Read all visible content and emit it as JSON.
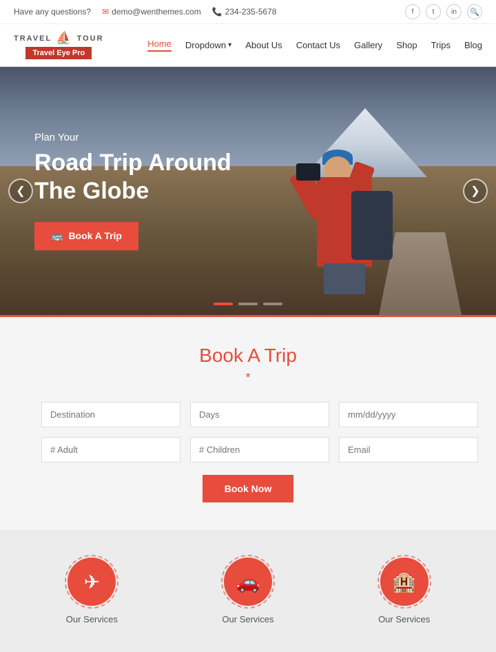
{
  "topbar": {
    "question": "Have any questions?",
    "email": "demo@wenthemes.com",
    "phone": "234-235-5678",
    "social": [
      "f",
      "t",
      "in"
    ],
    "search_symbol": "🔍"
  },
  "navbar": {
    "brand_line1": "TRAVEL",
    "brand_line2": "TOUR",
    "badge": "Travel Eye Pro",
    "links": [
      {
        "label": "Home",
        "active": true
      },
      {
        "label": "Dropdown",
        "has_arrow": true
      },
      {
        "label": "About Us"
      },
      {
        "label": "Contact Us"
      },
      {
        "label": "Gallery"
      },
      {
        "label": "Shop"
      },
      {
        "label": "Trips"
      },
      {
        "label": "Blog"
      }
    ]
  },
  "hero": {
    "subtitle": "Plan Your",
    "title_line1": "Road Trip Around",
    "title_line2": "The Globe",
    "cta_label": "Book A Trip",
    "dots": [
      {
        "active": true
      },
      {
        "active": false
      },
      {
        "active": false
      }
    ],
    "prev_arrow": "❮",
    "next_arrow": "❯"
  },
  "booking": {
    "title_prefix": "B",
    "title_rest": "ook A Trip",
    "divider_symbol": "*",
    "fields": [
      {
        "placeholder": "Destination",
        "name": "destination"
      },
      {
        "placeholder": "Days",
        "name": "days"
      },
      {
        "placeholder": "mm/dd/yyyy",
        "name": "date"
      },
      {
        "placeholder": "# Adult",
        "name": "adult"
      },
      {
        "placeholder": "# Children",
        "name": "children"
      },
      {
        "placeholder": "Email",
        "name": "email"
      }
    ],
    "btn_label": "Book Now"
  },
  "services": [
    {
      "label": "Our Services",
      "icon": "✈"
    },
    {
      "label": "Our Services",
      "icon": "🚗"
    },
    {
      "label": "Our Services",
      "icon": "🏠"
    }
  ]
}
